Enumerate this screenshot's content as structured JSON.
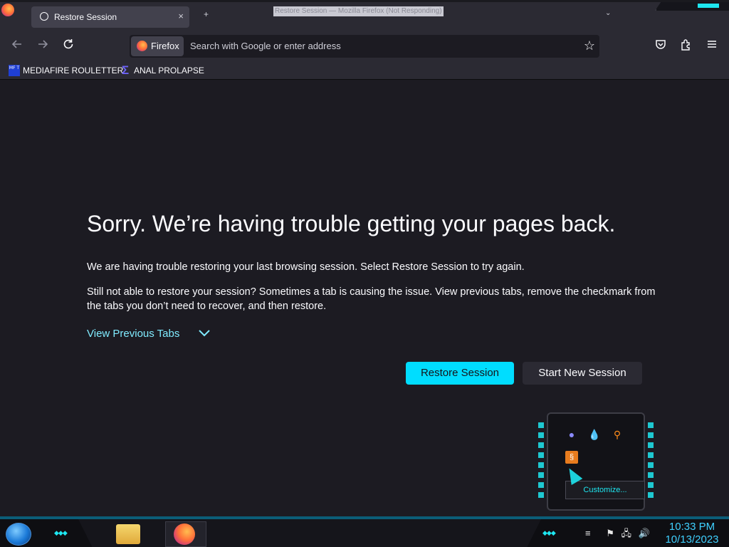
{
  "window": {
    "title": "Restore Session — Mozilla Firefox (Not Responding)",
    "tab_label": "Restore Session",
    "tab_close": "×"
  },
  "toolbar": {
    "back_icon": "arrow-left-icon",
    "forward_icon": "arrow-right-icon",
    "reload_icon": "reload-icon",
    "identity_label": "Firefox",
    "url_placeholder": "Search with Google or enter address",
    "star_icon": "star-icon",
    "pocket_icon": "pocket-icon",
    "extensions_icon": "extensions-icon",
    "menu_icon": "hamburger-menu-icon"
  },
  "bookmarks": [
    {
      "label": "MEDIAFIRE ROULETTER",
      "icon_text": "MF T"
    },
    {
      "label": "ANAL PROLAPSE",
      "icon": "sigma-icon"
    }
  ],
  "page": {
    "heading": "Sorry. We’re having trouble getting your pages back.",
    "paragraph1": "We are having trouble restoring your last browsing session. Select Restore Session to try again.",
    "paragraph2": "Still not able to restore your session? Sometimes a tab is causing the issue. View previous tabs, remove the checkmark from the tabs you don’t need to recover, and then restore.",
    "view_previous_tabs": "View Previous Tabs",
    "restore_button": "Restore Session",
    "new_session_button": "Start New Session"
  },
  "tray_popup": {
    "customize_label": "Customize..."
  },
  "taskbar": {
    "time": "10:33 PM",
    "date": "10/13/2023"
  },
  "colors": {
    "accent": "#00ddff",
    "link": "#80ebff",
    "background": "#1c1b22",
    "chrome": "#2b2a33",
    "clock": "#3fd0ff"
  }
}
